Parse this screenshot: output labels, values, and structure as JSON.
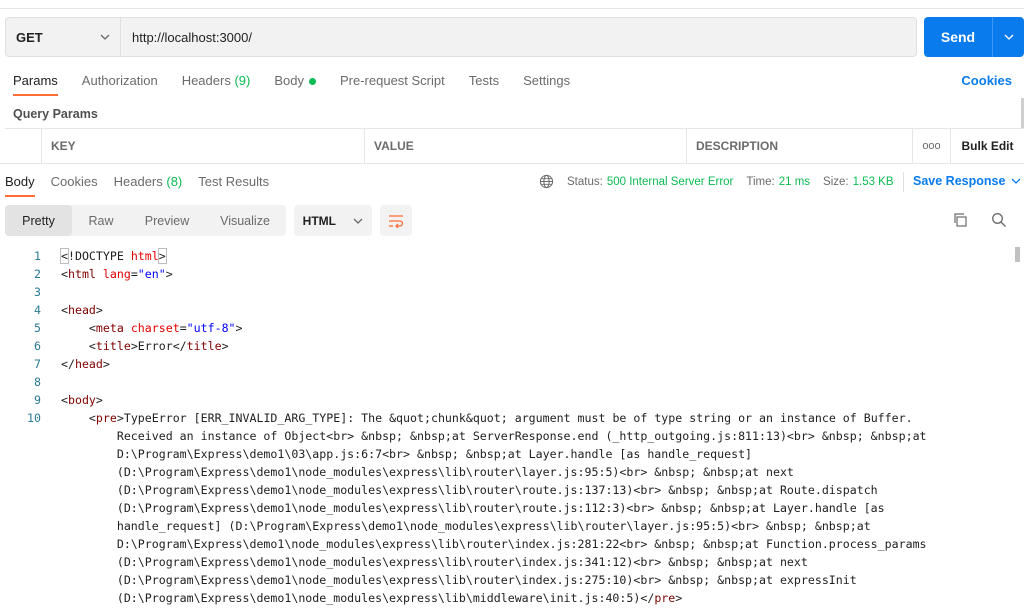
{
  "request": {
    "method": "GET",
    "url": "http://localhost:3000/",
    "send_label": "Send"
  },
  "request_tabs": [
    {
      "label": "Params",
      "active": true
    },
    {
      "label": "Authorization"
    },
    {
      "label": "Headers",
      "count": "(9)"
    },
    {
      "label": "Body",
      "dot": true
    },
    {
      "label": "Pre-request Script"
    },
    {
      "label": "Tests"
    },
    {
      "label": "Settings"
    }
  ],
  "cookies_label": "Cookies",
  "query_params_title": "Query Params",
  "params_table": {
    "key": "KEY",
    "value": "VALUE",
    "description": "DESCRIPTION",
    "more": "ooo",
    "bulk_edit": "Bulk Edit"
  },
  "response_tabs": [
    {
      "label": "Body",
      "active": true
    },
    {
      "label": "Cookies"
    },
    {
      "label": "Headers",
      "count": "(8)"
    },
    {
      "label": "Test Results"
    }
  ],
  "response_status": {
    "status_label": "Status:",
    "status_value": "500 Internal Server Error",
    "time_label": "Time:",
    "time_value": "21 ms",
    "size_label": "Size:",
    "size_value": "1.53 KB"
  },
  "save_response_label": "Save Response",
  "view_modes": [
    "Pretty",
    "Raw",
    "Preview",
    "Visualize"
  ],
  "language": "HTML",
  "colors": {
    "accent": "#097bed",
    "tab_active": "#ff6c37",
    "success": "#0cbb52"
  },
  "code_lines": [
    {
      "n": "1",
      "html": "<span class=\"hl\">&lt;</span>!DOCTYPE <span class=\"at\">html</span><span class=\"hl\">&gt;</span>"
    },
    {
      "n": "2",
      "html": "&lt;<span class=\"tag\">html</span> <span class=\"at\">lang</span>=<span class=\"str\">\"en\"</span>&gt;"
    },
    {
      "n": "3",
      "html": ""
    },
    {
      "n": "4",
      "html": "&lt;<span class=\"tag\">head</span>&gt;"
    },
    {
      "n": "5",
      "html": "    &lt;<span class=\"tag\">meta</span> <span class=\"at\">charset</span>=<span class=\"str\">\"utf-8\"</span>&gt;"
    },
    {
      "n": "6",
      "html": "    &lt;<span class=\"tag\">title</span>&gt;Error&lt;/<span class=\"tag\">title</span>&gt;"
    },
    {
      "n": "7",
      "html": "&lt;/<span class=\"tag\">head</span>&gt;"
    },
    {
      "n": "8",
      "html": ""
    },
    {
      "n": "9",
      "html": "&lt;<span class=\"tag\">body</span>&gt;"
    },
    {
      "n": "10",
      "html": "    &lt;<span class=\"tag\">pre</span>&gt;TypeError [ERR_INVALID_ARG_TYPE]: The &amp;quot;chunk&amp;quot; argument must be of type string or an instance of Buffer."
    },
    {
      "n": "",
      "html": "        Received an instance of Object&lt;br&gt; &amp;nbsp; &amp;nbsp;at ServerResponse.end (_http_outgoing.js:811:13)&lt;br&gt; &amp;nbsp; &amp;nbsp;at"
    },
    {
      "n": "",
      "html": "        D:\\Program\\Express\\demo1\\03\\app.js:6:7&lt;br&gt; &amp;nbsp; &amp;nbsp;at Layer.handle [as handle_request]"
    },
    {
      "n": "",
      "html": "        (D:\\Program\\Express\\demo1\\node_modules\\express\\lib\\router\\layer.js:95:5)&lt;br&gt; &amp;nbsp; &amp;nbsp;at next"
    },
    {
      "n": "",
      "html": "        (D:\\Program\\Express\\demo1\\node_modules\\express\\lib\\router\\route.js:137:13)&lt;br&gt; &amp;nbsp; &amp;nbsp;at Route.dispatch"
    },
    {
      "n": "",
      "html": "        (D:\\Program\\Express\\demo1\\node_modules\\express\\lib\\router\\route.js:112:3)&lt;br&gt; &amp;nbsp; &amp;nbsp;at Layer.handle [as"
    },
    {
      "n": "",
      "html": "        handle_request] (D:\\Program\\Express\\demo1\\node_modules\\express\\lib\\router\\layer.js:95:5)&lt;br&gt; &amp;nbsp; &amp;nbsp;at"
    },
    {
      "n": "",
      "html": "        D:\\Program\\Express\\demo1\\node_modules\\express\\lib\\router\\index.js:281:22&lt;br&gt; &amp;nbsp; &amp;nbsp;at Function.process_params"
    },
    {
      "n": "",
      "html": "        (D:\\Program\\Express\\demo1\\node_modules\\express\\lib\\router\\index.js:341:12)&lt;br&gt; &amp;nbsp; &amp;nbsp;at next"
    },
    {
      "n": "",
      "html": "        (D:\\Program\\Express\\demo1\\node_modules\\express\\lib\\router\\index.js:275:10)&lt;br&gt; &amp;nbsp; &amp;nbsp;at expressInit"
    },
    {
      "n": "",
      "html": "        (D:\\Program\\Express\\demo1\\node_modules\\express\\lib\\middleware\\init.js:40:5)&lt;/<span class=\"tag\">pre</span>&gt;"
    }
  ]
}
